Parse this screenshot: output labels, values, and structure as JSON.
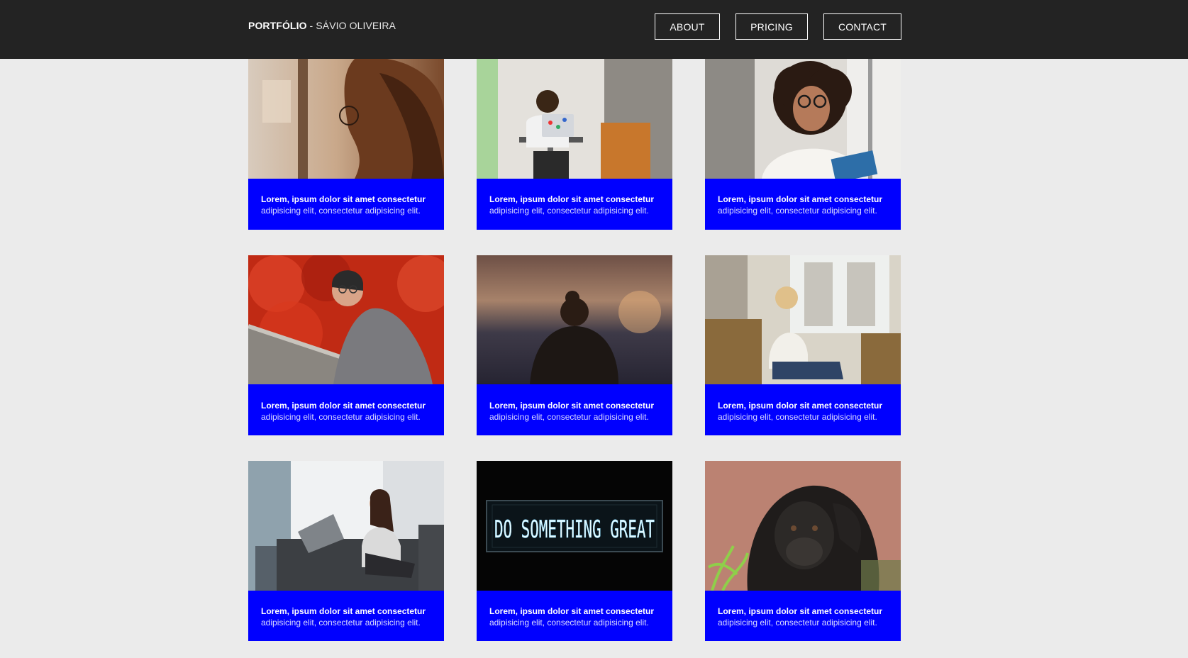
{
  "header": {
    "brand_strong": "PORTFÓLIO",
    "brand_sep": " - ",
    "brand_name": "SÁVIO OLIVEIRA",
    "nav": [
      {
        "label": "ABOUT"
      },
      {
        "label": "PRICING"
      },
      {
        "label": "CONTACT"
      }
    ]
  },
  "colors": {
    "header_bg": "#232323",
    "page_bg": "#ebebeb",
    "card_accent": "#0000ff"
  },
  "cards": [
    {
      "title": "Lorem, ipsum dolor sit amet consectetur",
      "text": "adipisicing elit, consectetur adipisicing elit.",
      "image": "woman-window-glasses-photo"
    },
    {
      "title": "Lorem, ipsum dolor sit amet consectetur",
      "text": "adipisicing elit, consectetur adipisicing elit.",
      "image": "man-laptop-stress-photo"
    },
    {
      "title": "Lorem, ipsum dolor sit amet consectetur",
      "text": "adipisicing elit, consectetur adipisicing elit.",
      "image": "woman-curly-hair-reading-photo"
    },
    {
      "title": "Lorem, ipsum dolor sit amet consectetur",
      "text": "adipisicing elit, consectetur adipisicing elit.",
      "image": "woman-red-leaves-smiling-photo"
    },
    {
      "title": "Lorem, ipsum dolor sit amet consectetur",
      "text": "adipisicing elit, consectetur adipisicing elit.",
      "image": "woman-sunset-city-view-photo"
    },
    {
      "title": "Lorem, ipsum dolor sit amet consectetur",
      "text": "adipisicing elit, consectetur adipisicing elit.",
      "image": "woman-armchair-window-photo"
    },
    {
      "title": "Lorem, ipsum dolor sit amet consectetur",
      "text": "adipisicing elit, consectetur adipisicing elit.",
      "image": "woman-laptop-couch-photo"
    },
    {
      "title": "Lorem, ipsum dolor sit amet consectetur",
      "text": "adipisicing elit, consectetur adipisicing elit.",
      "image": "neon-sign-photo",
      "neon_text": "DO SOMETHING GREAT"
    },
    {
      "title": "Lorem, ipsum dolor sit amet consectetur",
      "text": "adipisicing elit, consectetur adipisicing elit.",
      "image": "gorilla-photo"
    }
  ]
}
